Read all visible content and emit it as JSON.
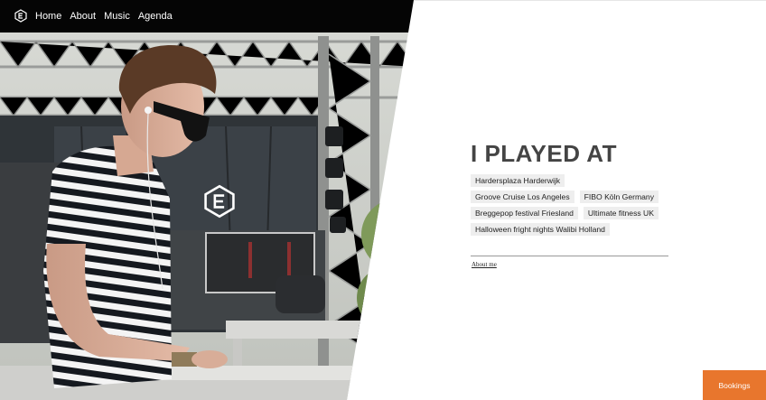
{
  "nav": {
    "logo_icon": "ce-monogram-icon",
    "items": [
      {
        "label": "Home"
      },
      {
        "label": "About"
      },
      {
        "label": "Music"
      },
      {
        "label": "Agenda"
      }
    ]
  },
  "hero": {
    "image": "dj-performing-on-stage-photo",
    "center_logo_icon": "ce-monogram-icon"
  },
  "main": {
    "heading": "I PLAYED AT",
    "venues": [
      "Hardersplaza Harderwijk",
      "Groove Cruise Los Angeles",
      "FIBO Köln Germany",
      "Breggepop festival Friesland",
      "Ultimate fitness UK",
      "Halloween fright nights Walibi Holland"
    ],
    "about_link": "About me"
  },
  "bookings_label": "Bookings",
  "colors": {
    "accent": "#e8762d",
    "heading": "#444444",
    "tag_bg": "#eeeeee",
    "nav_bg": "#000000"
  }
}
